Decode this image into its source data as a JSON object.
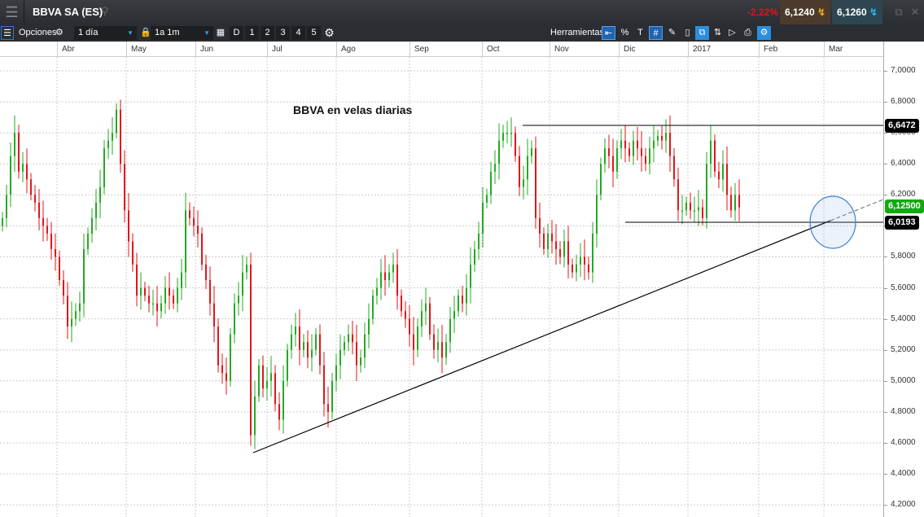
{
  "header": {
    "title": "BBVA SA (ES)",
    "change": "-2,22%",
    "bid": "6,1240",
    "ask": "6,1260"
  },
  "toolbar": {
    "options": "Opciones",
    "interval": "1 día",
    "range": "1a 1m",
    "d": "D",
    "p1": "1",
    "p2": "2",
    "p3": "3",
    "p4": "4",
    "p5": "5",
    "tools_label": "Herramientas"
  },
  "months": [
    "Abr",
    "May",
    "Jun",
    "Jul",
    "Ago",
    "Sep",
    "Oct",
    "Nov",
    "Dic",
    "2017",
    "Feb",
    "Mar"
  ],
  "annotation": "BBVA en velas diarias",
  "colors": {
    "up": "#22aa22",
    "down": "#e0161b",
    "current_price": "#12a812"
  },
  "chart_data": {
    "type": "candlestick",
    "ylim": [
      4.2,
      7.0
    ],
    "y_ticks": [
      "7,0000",
      "6,8000",
      "6,6000",
      "6,4000",
      "6,2000",
      "6,0000",
      "5,8000",
      "5,6000",
      "5,4000",
      "5,2000",
      "5,0000",
      "4,8000",
      "4,6000",
      "4,4000",
      "4,2000"
    ],
    "x_labels": [
      "Abr",
      "May",
      "Jun",
      "Jul",
      "Ago",
      "Sep",
      "Oct",
      "Nov",
      "Dic",
      "2017",
      "Feb",
      "Mar"
    ],
    "closes": [
      6.05,
      6.2,
      6.45,
      6.6,
      6.35,
      6.4,
      6.3,
      6.2,
      6.15,
      6.05,
      6.0,
      5.95,
      5.85,
      5.8,
      5.65,
      5.55,
      5.35,
      5.4,
      5.45,
      5.5,
      5.85,
      5.95,
      6.05,
      6.15,
      6.25,
      6.5,
      6.55,
      6.6,
      6.75,
      6.4,
      6.1,
      5.9,
      5.75,
      5.55,
      5.6,
      5.55,
      5.5,
      5.5,
      5.45,
      5.5,
      5.6,
      5.55,
      5.5,
      5.6,
      5.7,
      6.1,
      6.05,
      6.0,
      5.95,
      5.75,
      5.65,
      5.5,
      5.35,
      5.1,
      5.05,
      5.0,
      5.3,
      5.5,
      5.55,
      5.7,
      5.75,
      4.65,
      4.9,
      5.1,
      4.95,
      5.0,
      5.05,
      4.85,
      4.75,
      5.0,
      5.2,
      5.3,
      5.35,
      5.2,
      5.25,
      5.15,
      5.2,
      5.3,
      5.1,
      4.85,
      4.8,
      5.0,
      5.1,
      5.2,
      5.25,
      5.3,
      5.25,
      5.1,
      5.15,
      5.3,
      5.4,
      5.55,
      5.6,
      5.7,
      5.65,
      5.7,
      5.75,
      5.55,
      5.45,
      5.4,
      5.3,
      5.2,
      5.35,
      5.45,
      5.5,
      5.3,
      5.2,
      5.25,
      5.15,
      5.25,
      5.4,
      5.45,
      5.55,
      5.5,
      5.6,
      5.75,
      5.85,
      5.95,
      6.15,
      6.2,
      6.35,
      6.4,
      6.55,
      6.6,
      6.6,
      6.6,
      6.45,
      6.25,
      6.3,
      6.45,
      6.5,
      6.05,
      5.95,
      5.85,
      5.95,
      5.9,
      5.85,
      5.8,
      5.9,
      5.75,
      5.7,
      5.75,
      5.8,
      5.75,
      5.7,
      5.95,
      6.2,
      6.4,
      6.5,
      6.45,
      6.35,
      6.5,
      6.55,
      6.5,
      6.45,
      6.55,
      6.5,
      6.45,
      6.4,
      6.5,
      6.55,
      6.58,
      6.55,
      6.6,
      6.45,
      6.3,
      6.1,
      6.1,
      6.15,
      6.1,
      6.1,
      6.12,
      6.05,
      6.4,
      6.55,
      6.35,
      6.3,
      6.4,
      6.2,
      6.1,
      6.2,
      6.12
    ],
    "resistance": "6,6472",
    "support": "6,0193",
    "current": "6,12500"
  }
}
